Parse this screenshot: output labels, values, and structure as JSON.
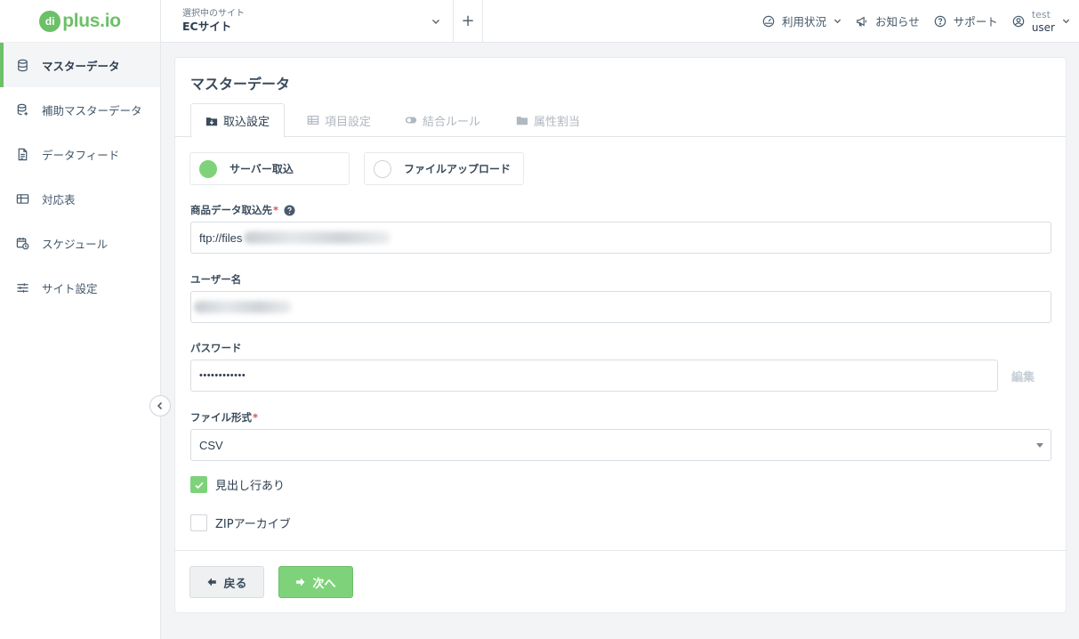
{
  "logo": {
    "badge": "di",
    "word": "plus.io"
  },
  "sidebar": {
    "items": [
      {
        "label": "マスターデータ",
        "icon": "database-icon",
        "active": true
      },
      {
        "label": "補助マスターデータ",
        "icon": "database-plus-icon"
      },
      {
        "label": "データフィード",
        "icon": "document-icon"
      },
      {
        "label": "対応表",
        "icon": "table-icon"
      },
      {
        "label": "スケジュール",
        "icon": "calendar-clock-icon"
      },
      {
        "label": "サイト設定",
        "icon": "sliders-icon"
      }
    ]
  },
  "header": {
    "site_label": "選択中のサイト",
    "site_value": "ECサイト",
    "add_symbol": "+",
    "usage": "利用状況",
    "news": "お知らせ",
    "support": "サポート",
    "user_line1": "test",
    "user_line2": "user"
  },
  "card": {
    "title": "マスターデータ",
    "tabs": [
      "取込設定",
      "項目設定",
      "結合ルール",
      "属性割当"
    ]
  },
  "form": {
    "radio_server": "サーバー取込",
    "radio_upload": "ファイルアップロード",
    "source_label": "商品データ取込先",
    "source_value": "ftp://files",
    "username_label": "ユーザー名",
    "password_label": "パスワード",
    "password_value": "••••••••••••",
    "edit_label": "編集",
    "file_format_label": "ファイル形式",
    "file_format_value": "CSV",
    "header_row_label": "見出し行あり",
    "header_row_checked": true,
    "zip_label": "ZIPアーカイブ",
    "zip_checked": false,
    "required_mark": "*"
  },
  "buttons": {
    "back": "戻る",
    "next": "次へ"
  },
  "colors": {
    "accent": "#7ed37a",
    "accent_dark": "#6cc067",
    "required": "#d9534f"
  }
}
